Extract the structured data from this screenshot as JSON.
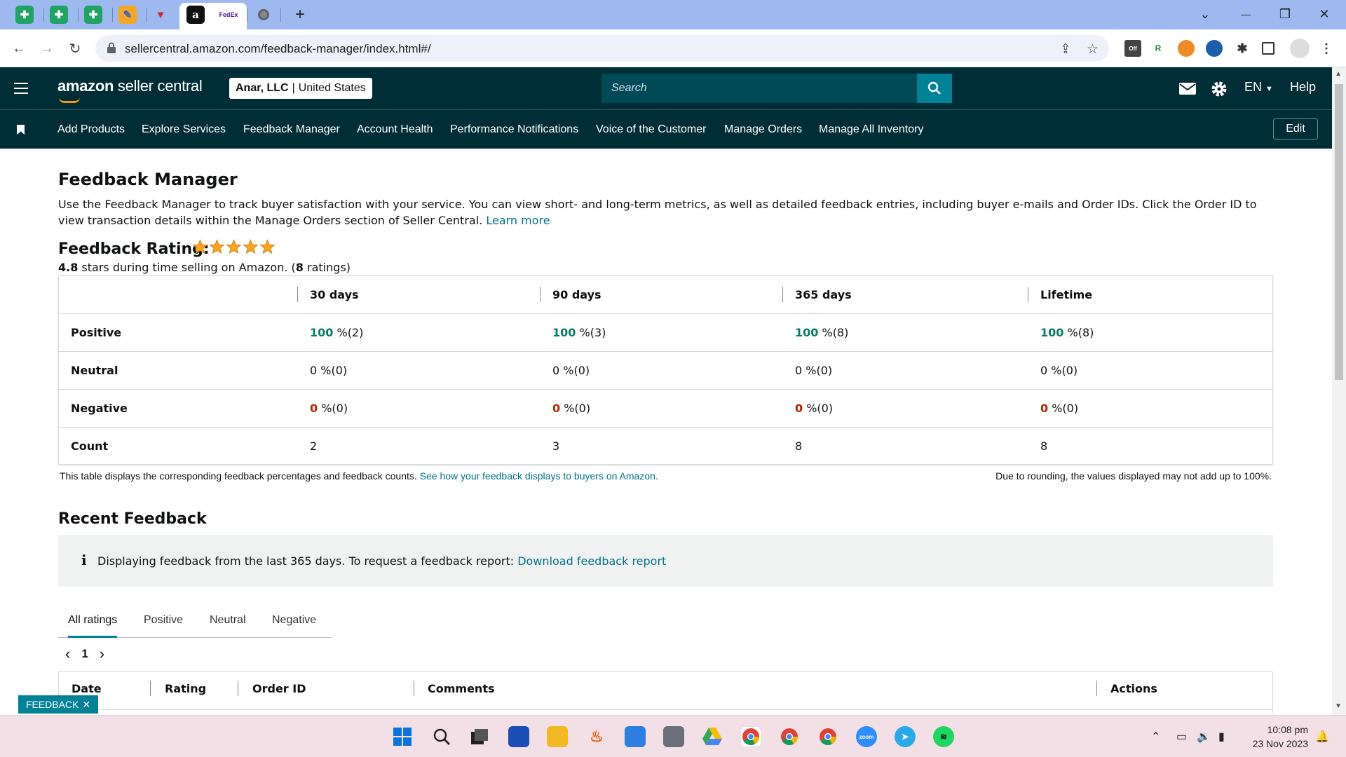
{
  "browser": {
    "url": "sellercentral.amazon.com/feedback-manager/index.html#/",
    "new_tab_symbol": "+",
    "window_controls": {
      "chevron": "⌄",
      "minimize": "—",
      "restore": "❐",
      "close": "✕"
    }
  },
  "header": {
    "logo_bold": "amazon",
    "logo_rest": " seller central",
    "account_name": "Anar, LLC",
    "account_sep": "|",
    "account_region": "United States",
    "search_placeholder": "Search",
    "language": "EN",
    "help": "Help"
  },
  "subnav": {
    "items": [
      "Add Products",
      "Explore Services",
      "Feedback Manager",
      "Account Health",
      "Performance Notifications",
      "Voice of the Customer",
      "Manage Orders",
      "Manage All Inventory"
    ],
    "edit": "Edit"
  },
  "page": {
    "title": "Feedback Manager",
    "description": "Use the Feedback Manager to track buyer satisfaction with your service. You can view short- and long-term metrics, as well as detailed feedback entries, including buyer e-mails and Order IDs. Click the Order ID to view transaction details within the Manage Orders section of Seller Central.",
    "learn_more": "Learn more",
    "rating_title": "Feedback Rating:",
    "rating_stars": 5,
    "rating_value": "4.8",
    "rating_text_mid": " stars during time selling on Amazon. (",
    "rating_count": "8",
    "rating_text_end": " ratings)"
  },
  "feedback_table": {
    "columns": [
      "30 days",
      "90 days",
      "365 days",
      "Lifetime"
    ],
    "rows": [
      {
        "label": "Positive",
        "values": [
          {
            "pct": "100",
            "rest": " %(2)"
          },
          {
            "pct": "100",
            "rest": " %(3)"
          },
          {
            "pct": "100",
            "rest": " %(8)"
          },
          {
            "pct": "100",
            "rest": " %(8)"
          }
        ]
      },
      {
        "label": "Neutral",
        "values": [
          {
            "pct": "0",
            "rest": " %(0)"
          },
          {
            "pct": "0",
            "rest": " %(0)"
          },
          {
            "pct": "0",
            "rest": " %(0)"
          },
          {
            "pct": "0",
            "rest": " %(0)"
          }
        ]
      },
      {
        "label": "Negative",
        "values": [
          {
            "pct": "0",
            "rest": " %(0)"
          },
          {
            "pct": "0",
            "rest": " %(0)"
          },
          {
            "pct": "0",
            "rest": " %(0)"
          },
          {
            "pct": "0",
            "rest": " %(0)"
          }
        ]
      },
      {
        "label": "Count",
        "values": [
          {
            "pct": "2",
            "rest": ""
          },
          {
            "pct": "3",
            "rest": ""
          },
          {
            "pct": "8",
            "rest": ""
          },
          {
            "pct": "8",
            "rest": ""
          }
        ]
      }
    ],
    "note_left": "This table displays the corresponding feedback percentages and feedback counts.",
    "note_link": "See how your feedback displays to buyers on Amazon.",
    "note_right": "Due to rounding, the values displayed may not add up to 100%."
  },
  "recent": {
    "title": "Recent Feedback",
    "info_icon": "i",
    "info_text": "Displaying feedback from the last 365 days. To request a feedback report:",
    "info_link": "Download feedback report",
    "tabs": [
      "All ratings",
      "Positive",
      "Neutral",
      "Negative"
    ],
    "page": "1",
    "prev_symbol": "‹",
    "next_symbol": "›",
    "columns": [
      "Date",
      "Rating",
      "Order ID",
      "Comments",
      "Actions"
    ]
  },
  "feedback_widget": {
    "label": "FEEDBACK",
    "close_symbol": "✕"
  },
  "taskbar": {
    "time": "10:08 pm",
    "date": "23 Nov 2023"
  },
  "colors": {
    "header_bg": "#002e36",
    "accent": "#008296",
    "positive": "#067d62",
    "negative": "#b12704",
    "star": "#ffa41c"
  }
}
